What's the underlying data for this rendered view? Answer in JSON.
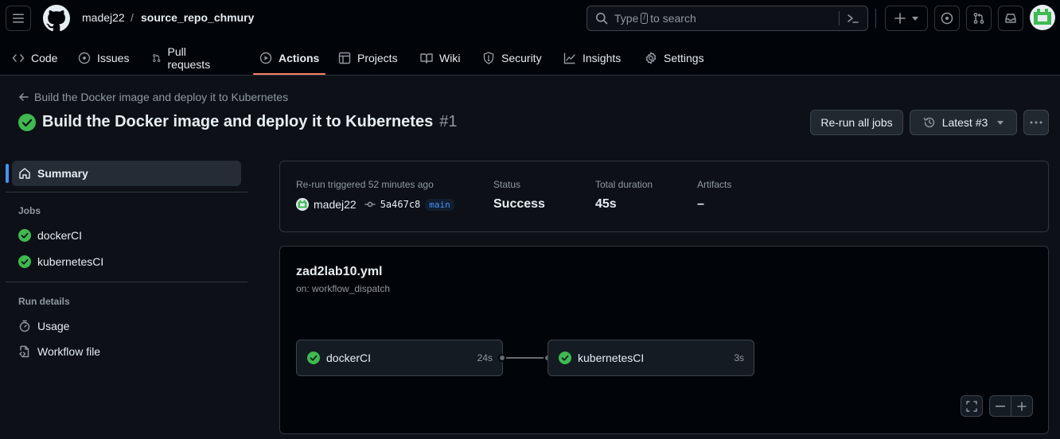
{
  "header": {
    "owner": "madej22",
    "separator": "/",
    "repo": "source_repo_chmury",
    "search": {
      "prefix": "Type",
      "key": "/",
      "suffix": "to search"
    }
  },
  "nav": [
    {
      "label": "Code",
      "icon": "code-icon"
    },
    {
      "label": "Issues",
      "icon": "issue-icon"
    },
    {
      "label": "Pull requests",
      "icon": "pull-request-icon"
    },
    {
      "label": "Actions",
      "icon": "play-icon",
      "active": true
    },
    {
      "label": "Projects",
      "icon": "table-icon"
    },
    {
      "label": "Wiki",
      "icon": "book-icon"
    },
    {
      "label": "Security",
      "icon": "shield-icon"
    },
    {
      "label": "Insights",
      "icon": "graph-icon"
    },
    {
      "label": "Settings",
      "icon": "gear-icon"
    }
  ],
  "run": {
    "back_label": "Build the Docker image and deploy it to Kubernetes",
    "title": "Build the Docker image and deploy it to Kubernetes",
    "number": "#1",
    "rerun_button": "Re-run all jobs",
    "attempt_button": "Latest #3"
  },
  "sidebar": {
    "summary": "Summary",
    "jobs_heading": "Jobs",
    "jobs": [
      "dockerCI",
      "kubernetesCI"
    ],
    "run_details_heading": "Run details",
    "usage": "Usage",
    "workflow_file": "Workflow file"
  },
  "summary": {
    "trigger_label": "Re-run triggered 52 minutes ago",
    "actor": "madej22",
    "commit": "5a467c8",
    "branch": "main",
    "status_label": "Status",
    "status_value": "Success",
    "duration_label": "Total duration",
    "duration_value": "45s",
    "artifacts_label": "Artifacts",
    "artifacts_value": "–"
  },
  "workflow": {
    "file": "zad2lab10.yml",
    "trigger": "on: workflow_dispatch",
    "jobs": [
      {
        "name": "dockerCI",
        "duration": "24s"
      },
      {
        "name": "kubernetesCI",
        "duration": "3s"
      }
    ]
  },
  "colors": {
    "success": "#3fb950",
    "accent": "#4493f8",
    "active_tab": "#f78166"
  }
}
